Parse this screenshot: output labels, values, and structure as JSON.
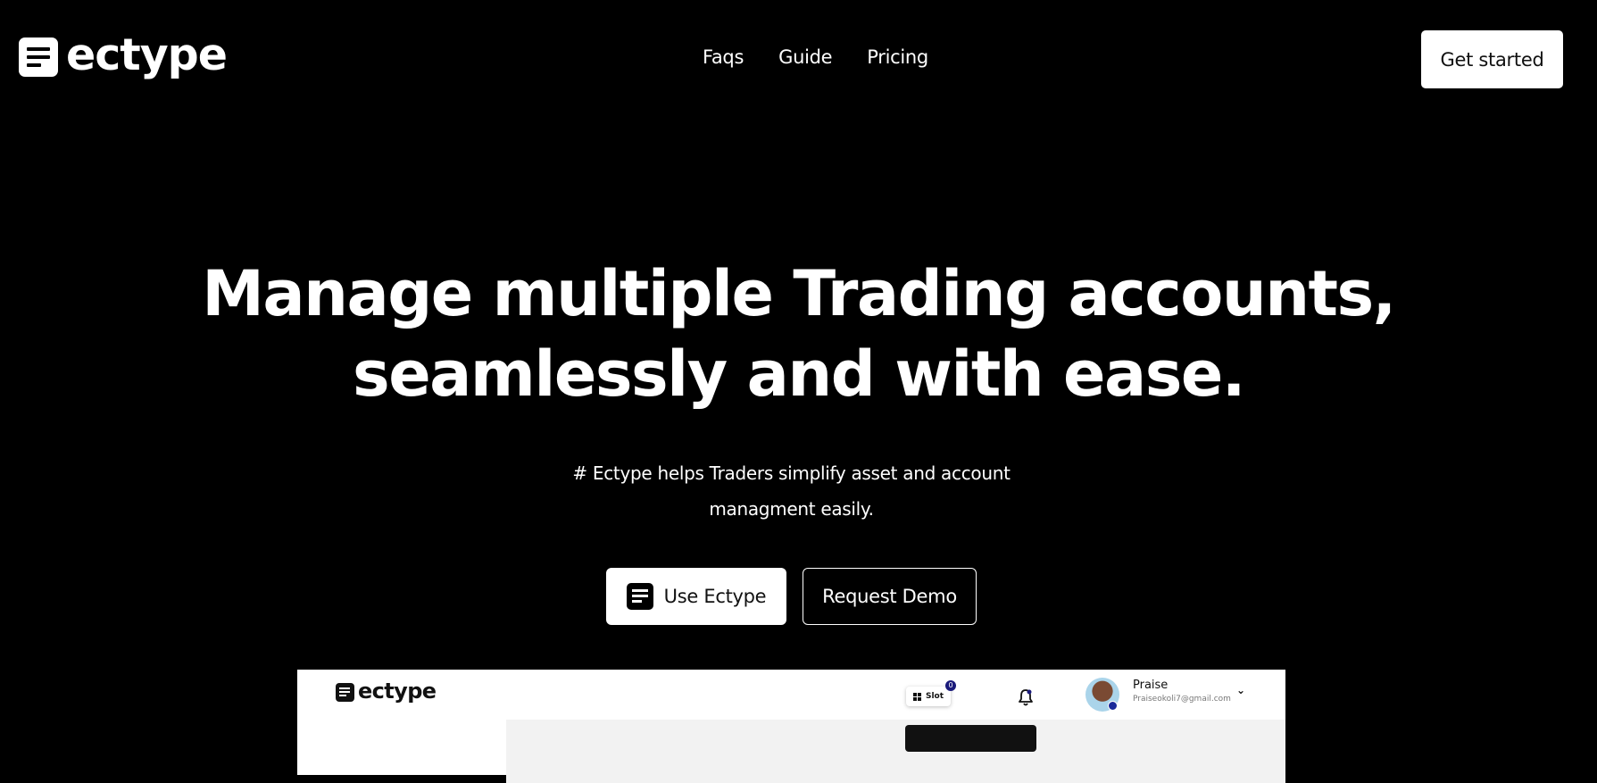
{
  "brand": {
    "name": "ectype"
  },
  "nav": {
    "links": [
      "Faqs",
      "Guide",
      "Pricing"
    ],
    "cta_label": "Get started"
  },
  "hero": {
    "title_line1": "Manage multiple Trading accounts,",
    "title_line2": "seamlessly and with ease.",
    "subtitle": "# Ectype helps Traders simplify asset and account managment easily.",
    "primary_label": "Use Ectype",
    "secondary_label": "Request Demo"
  },
  "preview": {
    "brand_name": "ectype",
    "slot_label": "Slot",
    "slot_count": "0",
    "user_name": "Praise",
    "user_email": "Praiseokoli7@gmail.com"
  },
  "colors": {
    "background": "#000000",
    "foreground": "#ffffff",
    "preview_content_bg": "#f2f2f2",
    "badge": "#1a1a7a"
  },
  "icons": [
    "ectype-logo-icon",
    "slot-grid-icon",
    "bell-icon",
    "chevron-down-icon",
    "user-avatar"
  ]
}
